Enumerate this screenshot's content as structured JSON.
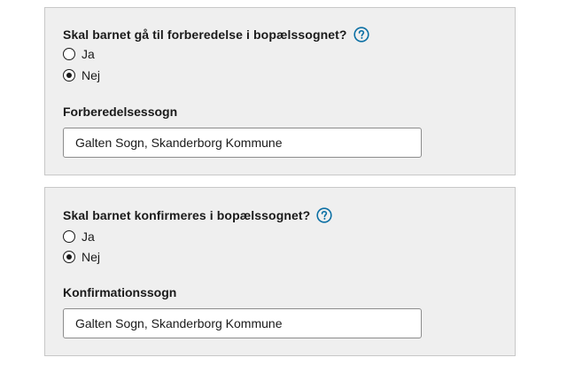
{
  "sections": [
    {
      "question": "Skal barnet gå til forberedelse i bopælssognet?",
      "help_icon": "question-circle-icon",
      "options": [
        {
          "label": "Ja",
          "checked": false
        },
        {
          "label": "Nej",
          "checked": true
        }
      ],
      "field_label": "Forberedelsessogn",
      "field_value": "Galten Sogn, Skanderborg Kommune"
    },
    {
      "question": "Skal barnet konfirmeres i bopælssognet?",
      "help_icon": "question-circle-icon",
      "options": [
        {
          "label": "Ja",
          "checked": false
        },
        {
          "label": "Nej",
          "checked": true
        }
      ],
      "field_label": "Konfirmationssogn",
      "field_value": "Galten Sogn, Skanderborg Kommune"
    }
  ],
  "colors": {
    "panel_background": "#efefef",
    "panel_border": "#c8c8c8",
    "help_icon": "#0b6fa4",
    "text": "#1a1a1a"
  }
}
